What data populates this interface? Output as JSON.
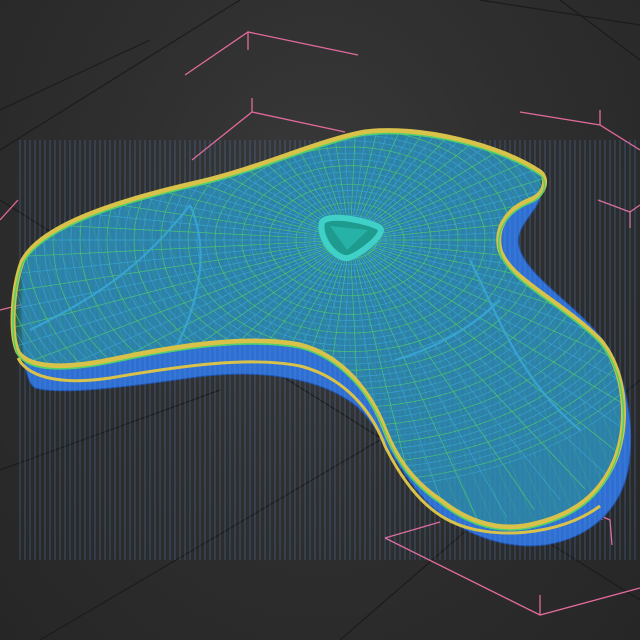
{
  "viewport": {
    "background": "#2e2e2e",
    "grid_color": "#1c1c1c",
    "bounding_box_color": "#e26a9c"
  },
  "mesh": {
    "colors": {
      "top_wire": "#4fd06a",
      "mid_wire": "#3aa7d6",
      "rim": "#d9c24a",
      "underside": "#2f6fd1",
      "emblem": "#3fd1c8"
    },
    "emblem_icon": "triangle-icon"
  }
}
